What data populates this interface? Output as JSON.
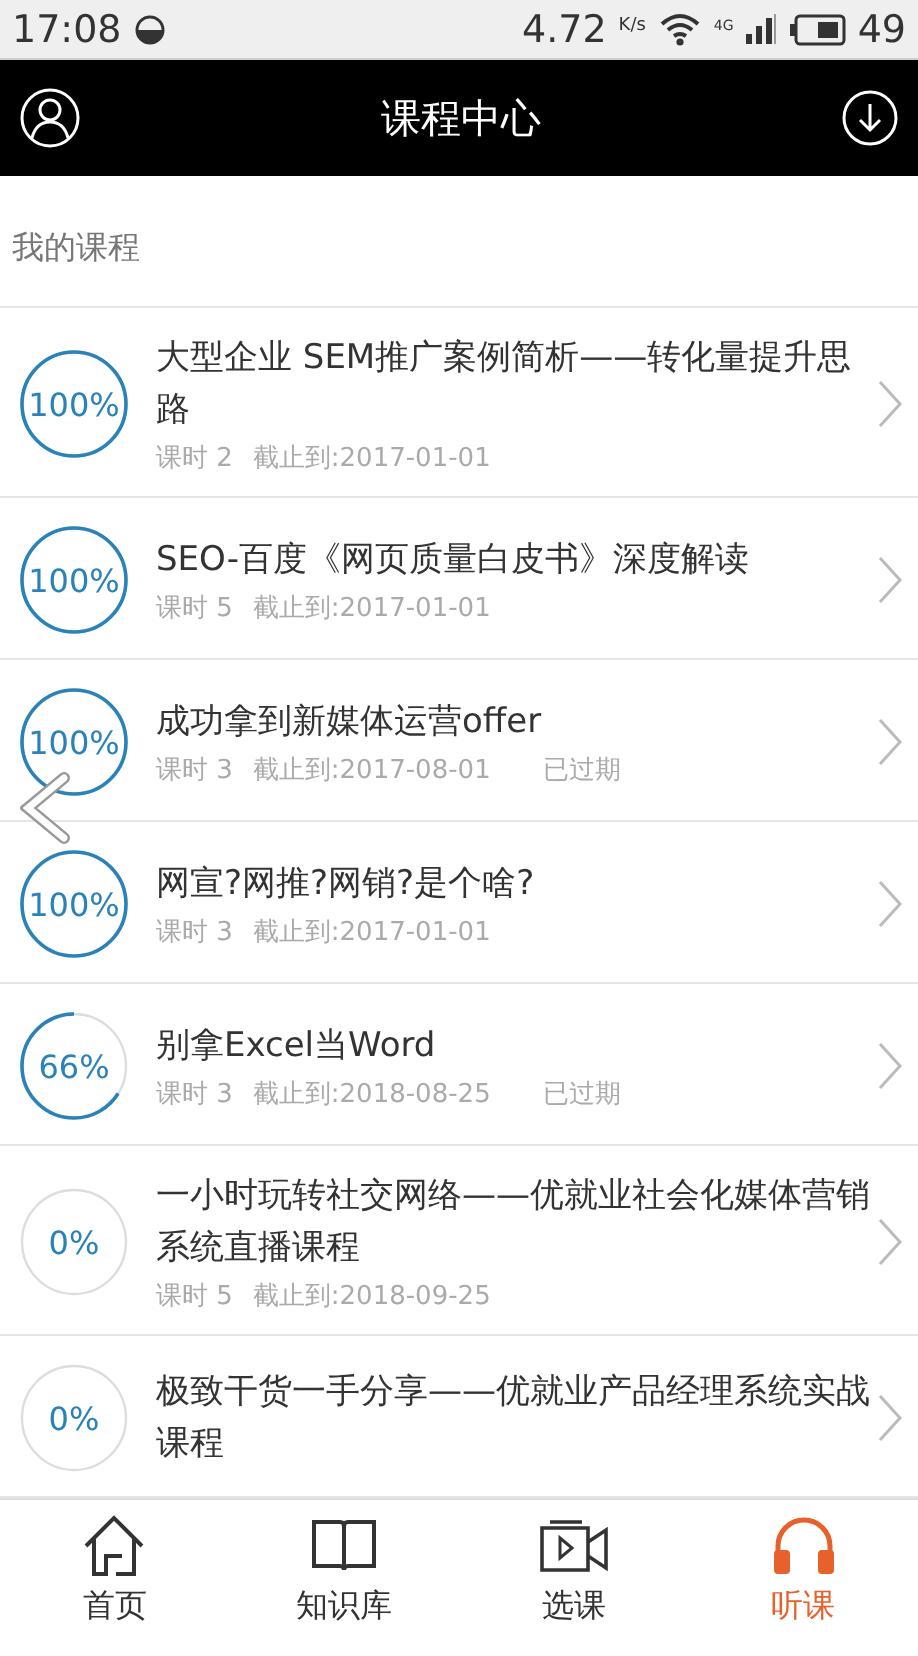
{
  "status_bar": {
    "time": "17:08",
    "speed": "4.72",
    "speed_unit": "K/s",
    "network": "4G",
    "battery": "49"
  },
  "header": {
    "title": "课程中心"
  },
  "section_title": "我的课程",
  "courses": [
    {
      "progress": "100%",
      "title": "大型企业 SEM推广案例简析——转化量提升思路",
      "lessons": "课时 2",
      "deadline": "截止到:2017-01-01"
    },
    {
      "progress": "100%",
      "title": "SEO-百度《网页质量白皮书》深度解读",
      "lessons": "课时 5",
      "deadline": "截止到:2017-01-01"
    },
    {
      "progress": "100%",
      "title": "成功拿到新媒体运营offer",
      "lessons": "课时 3",
      "deadline": "截止到:2017-08-01",
      "status": "已过期"
    },
    {
      "progress": "100%",
      "title": "网宣?网推?网销?是个啥?",
      "lessons": "课时 3",
      "deadline": "截止到:2017-01-01"
    },
    {
      "progress": "66%",
      "title": "别拿Excel当Word",
      "lessons": "课时 3",
      "deadline": "截止到:2018-08-25",
      "status": "已过期"
    },
    {
      "progress": "0%",
      "title": "一小时玩转社交网络——优就业社会化媒体营销系统直播课程",
      "lessons": "课时 5",
      "deadline": "截止到:2018-09-25"
    },
    {
      "progress": "0%",
      "title": "极致干货一手分享——优就业产品经理系统实战课程"
    }
  ],
  "tabs": [
    {
      "kind": "home",
      "label": "首页",
      "selected": false
    },
    {
      "kind": "book",
      "label": "知识库",
      "selected": false
    },
    {
      "kind": "video",
      "label": "选课",
      "selected": false
    },
    {
      "kind": "headphones",
      "label": "听课",
      "selected": true
    }
  ]
}
